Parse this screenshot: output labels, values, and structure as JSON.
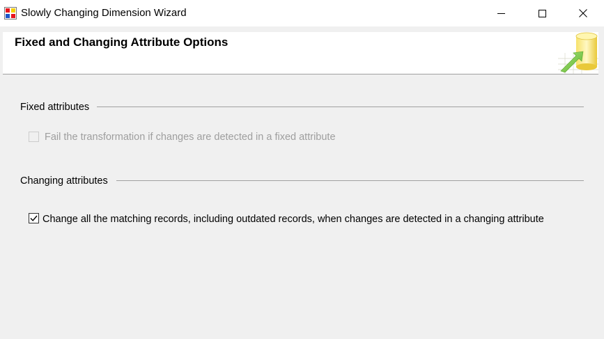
{
  "window": {
    "title": "Slowly Changing Dimension Wizard",
    "icon": "wizard-app-icon",
    "controls": {
      "minimize_icon": "minimize-icon",
      "maximize_icon": "maximize-icon",
      "close_icon": "close-icon"
    }
  },
  "header": {
    "title": "Fixed and Changing Attribute Options",
    "graphic_icon": "database-arrow-icon"
  },
  "fixed_attributes": {
    "group_label": "Fixed attributes",
    "checkbox": {
      "label": "Fail the transformation if changes are detected in a fixed attribute",
      "checked": false,
      "enabled": false
    }
  },
  "changing_attributes": {
    "group_label": "Changing attributes",
    "checkbox": {
      "label": "Change all the matching records, including outdated records, when changes are detected in a changing attribute",
      "checked": true,
      "enabled": true
    }
  },
  "colors": {
    "background": "#f0f0f0",
    "disabled_text": "#9e9e9e",
    "separator": "#a0a0a0"
  }
}
